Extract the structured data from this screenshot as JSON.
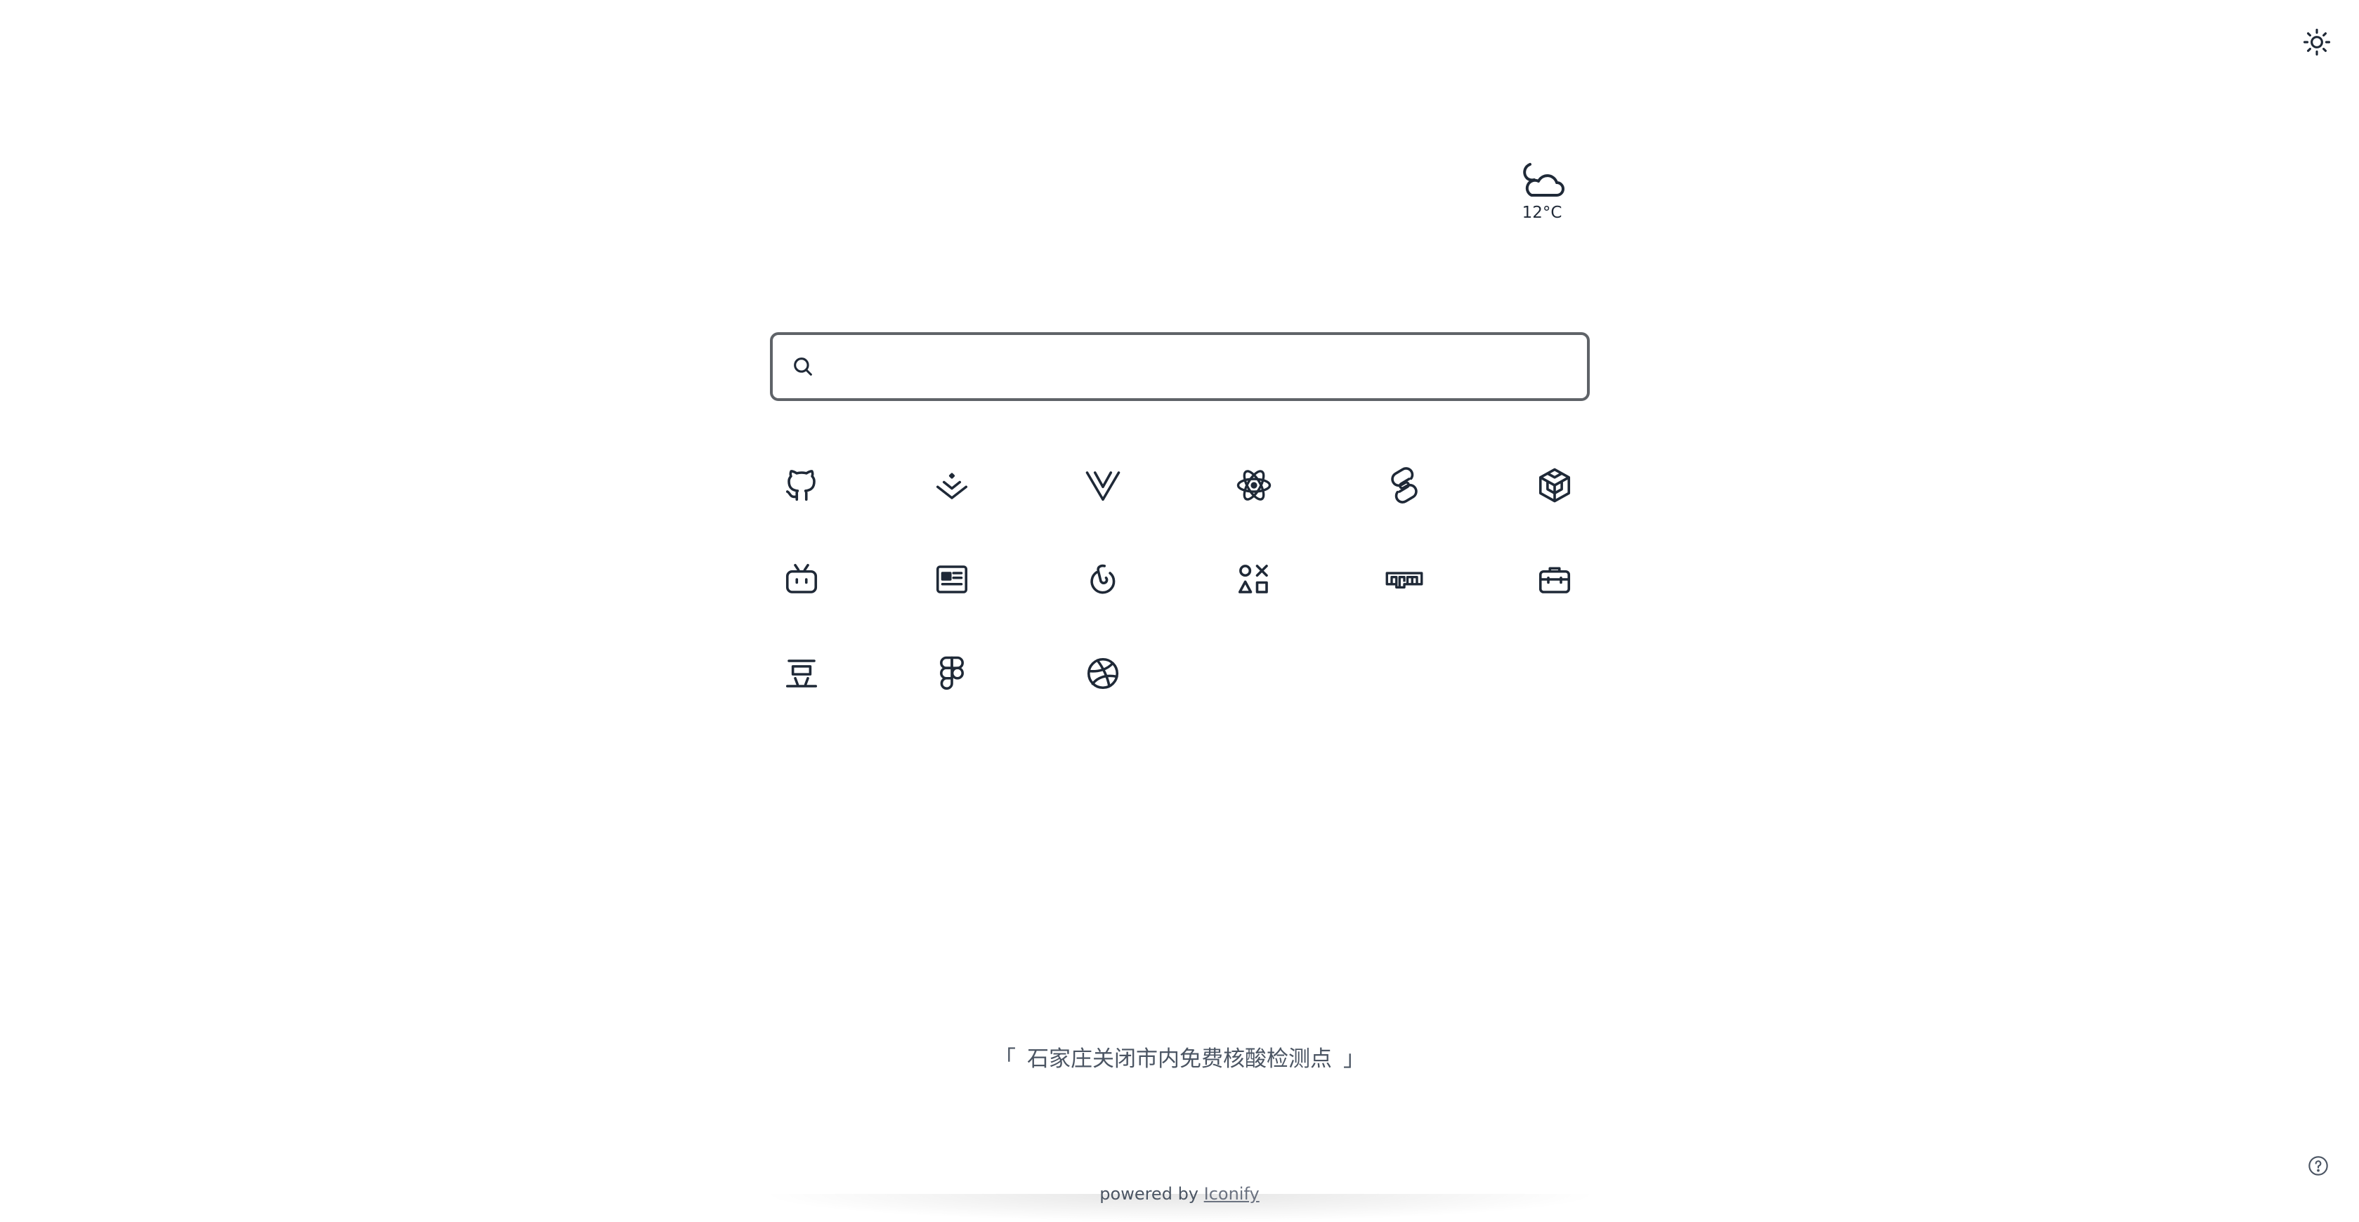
{
  "header": {
    "theme_toggle_icon": "sun-icon"
  },
  "weather": {
    "icon": "moon-cloud-icon",
    "temperature": "12°C"
  },
  "search": {
    "icon": "search-icon",
    "placeholder": "",
    "value": ""
  },
  "links": [
    {
      "name": "github",
      "icon": "github-icon"
    },
    {
      "name": "juejin",
      "icon": "juejin-icon"
    },
    {
      "name": "vue",
      "icon": "vue-icon"
    },
    {
      "name": "react",
      "icon": "react-icon"
    },
    {
      "name": "svelte",
      "icon": "svelte-icon"
    },
    {
      "name": "codesandbox",
      "icon": "codesandbox-icon"
    },
    {
      "name": "bilibili",
      "icon": "bilibili-icon"
    },
    {
      "name": "news",
      "icon": "newspaper-icon"
    },
    {
      "name": "netease-music",
      "icon": "netease-music-icon"
    },
    {
      "name": "shapes",
      "icon": "shapes-icon"
    },
    {
      "name": "npm",
      "icon": "npm-icon"
    },
    {
      "name": "toolbox",
      "icon": "toolbox-icon"
    },
    {
      "name": "douban",
      "icon": "douban-icon"
    },
    {
      "name": "figma",
      "icon": "figma-icon"
    },
    {
      "name": "dribbble",
      "icon": "dribbble-icon"
    }
  ],
  "quote": {
    "open": "「",
    "text": "石家庄关闭市内免费核酸检测点",
    "close": "」"
  },
  "footer": {
    "prefix": "powered by",
    "link_label": "Iconify"
  },
  "help": {
    "icon": "question-circle-icon"
  },
  "colors": {
    "icon": "#1f2937",
    "search_border": "#5f6368",
    "muted_text": "#4b5563"
  }
}
